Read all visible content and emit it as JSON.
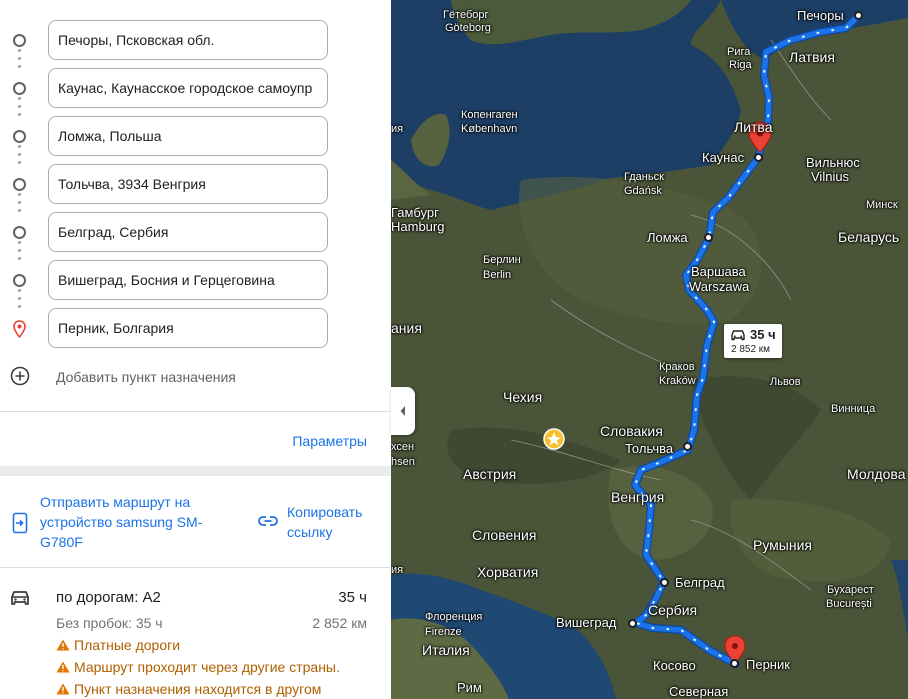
{
  "stops": [
    {
      "value": "Печоры, Псковская обл."
    },
    {
      "value": "Каунас, Каунасское городское самоупр"
    },
    {
      "value": "Ломжа, Польша"
    },
    {
      "value": "Тольчва, 3934 Венгрия"
    },
    {
      "value": "Белград, Сербия"
    },
    {
      "value": "Вишеград, Босния и Герцеговина"
    },
    {
      "value": "Перник, Болгария"
    }
  ],
  "add_destination": "Добавить пункт назначения",
  "parameters": "Параметры",
  "send_route": "Отправить маршрут на устройство samsung SM-G780F",
  "copy_link": "Копировать ссылку",
  "route": {
    "name": "по дорогам: A2",
    "time": "35 ч",
    "no_traffic": "Без пробок: 35 ч",
    "distance": "2 852 км",
    "warnings": [
      "Платные дороги",
      "Маршрут проходит через другие страны.",
      "Пункт назначения находится в другом"
    ]
  },
  "map": {
    "duration_box": {
      "time": "35 ч",
      "distance": "2 852 км"
    },
    "labels": {
      "goteborg_ru": "Гётеборг",
      "goteborg": "Göteborg",
      "pechory": "Печоры",
      "riga_ru": "Рига",
      "riga": "Riga",
      "latvia": "Латвия",
      "litva": "Литва",
      "kaunas": "Каунас",
      "vilnius_ru": "Вильнюс",
      "vilnius": "Vilnius",
      "minsk": "Минск",
      "belarus": "Беларусь",
      "kopenhagen_ru": "Копенгаген",
      "kopenhagen": "København",
      "gdansk_ru": "Гданьск",
      "gdansk": "Gdańsk",
      "hamburg_ru": "Гамбург",
      "hamburg": "Hamburg",
      "lomzha": "Ломжа",
      "berlin_ru": "Берлин",
      "berlin": "Berlin",
      "warsaw_ru": "Варшава",
      "warsaw": "Warszawa",
      "germany_part": "ания",
      "krakow_ru": "Краков",
      "krakow": "Kraków",
      "lviv": "Львов",
      "czech": "Чехия",
      "vinnitsa": "Винница",
      "slovakia": "Словакия",
      "tolchva": "Тольчва",
      "saxony_ru": "хсен",
      "saxony": "hsen",
      "austria": "Австрия",
      "hungary": "Венгрия",
      "moldova": "Молдова",
      "slovenia": "Словения",
      "romania": "Румыния",
      "croatia": "Хорватия",
      "belgrade": "Белград",
      "bucharest_ru": "Бухарест",
      "bucharest": "București",
      "florence_ru": "Флоренция",
      "florence": "Firenze",
      "serbia": "Сербия",
      "visegrad": "Вишеград",
      "italy": "Италия",
      "kosovo": "Косово",
      "pernik": "Перник",
      "rome": "Рим",
      "north": "Северная",
      "sweden_part": "ия",
      "venice_part": "ия"
    }
  },
  "colors": {
    "route": "#1a73e8",
    "link": "#1a73e8",
    "warning": "#b06000",
    "pin": "#ea4335"
  }
}
